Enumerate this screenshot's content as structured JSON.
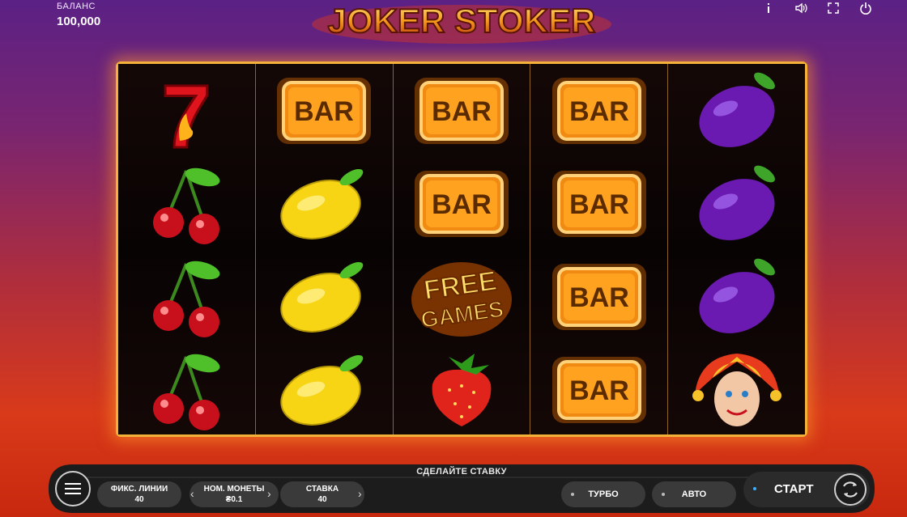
{
  "balance": {
    "label": "БАЛАНС",
    "value": "100,000"
  },
  "logo": {
    "text": "JOKER STOKER"
  },
  "top_icons": [
    "info-icon",
    "sound-icon",
    "fullscreen-icon",
    "power-icon"
  ],
  "reels": [
    [
      "seven",
      "cherry",
      "cherry",
      "cherry"
    ],
    [
      "bar",
      "lemon",
      "lemon",
      "lemon"
    ],
    [
      "bar",
      "bar",
      "free-games",
      "strawberry"
    ],
    [
      "bar",
      "bar",
      "bar",
      "bar"
    ],
    [
      "plum",
      "plum",
      "plum",
      "joker"
    ]
  ],
  "symbols": {
    "bar_text": "BAR",
    "seven_text": "7",
    "free_line1": "FREE",
    "free_line2": "GAMES"
  },
  "bottom": {
    "hint": "СДЕЛАЙТЕ СТАВКУ",
    "lines": {
      "label": "ФИКС. ЛИНИИ",
      "value": "40"
    },
    "coin": {
      "label": "НОМ. МОНЕТЫ",
      "value": "₴0.1"
    },
    "bet": {
      "label": "СТАВКА",
      "value": "40"
    },
    "turbo": "ТУРБО",
    "auto": "АВТО",
    "start": "СТАРТ"
  },
  "colors": {
    "frame": "#f4b13a",
    "accent": "#3ab0ff"
  }
}
